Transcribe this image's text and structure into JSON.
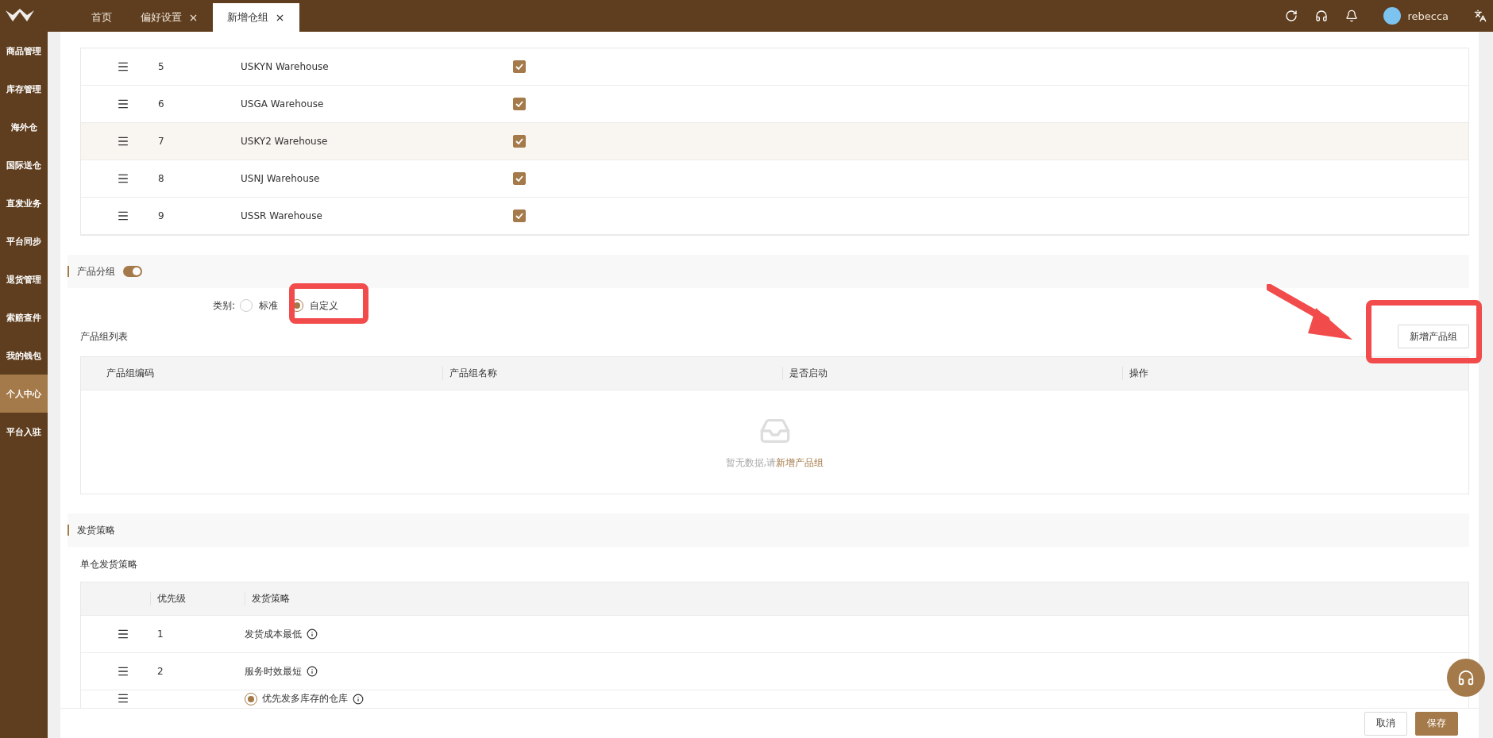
{
  "topbar": {
    "tabs": [
      {
        "label": "首页",
        "closable": false,
        "selected": false
      },
      {
        "label": "偏好设置",
        "closable": true,
        "selected": false
      },
      {
        "label": "新增仓组",
        "closable": true,
        "selected": true
      }
    ],
    "user": "rebecca"
  },
  "sidebar": {
    "items": [
      {
        "label": "商品管理",
        "selected": false
      },
      {
        "label": "库存管理",
        "selected": false
      },
      {
        "label": "海外仓",
        "selected": false
      },
      {
        "label": "国际送仓",
        "selected": false
      },
      {
        "label": "直发业务",
        "selected": false
      },
      {
        "label": "平台同步",
        "selected": false
      },
      {
        "label": "退货管理",
        "selected": false
      },
      {
        "label": "索赔查件",
        "selected": false
      },
      {
        "label": "我的钱包",
        "selected": false
      },
      {
        "label": "个人中心",
        "selected": true
      },
      {
        "label": "平台入驻",
        "selected": false
      }
    ]
  },
  "warehouses": {
    "rows": [
      {
        "index": "5",
        "name": "USKYN Warehouse",
        "checked": true,
        "highlighted": false
      },
      {
        "index": "6",
        "name": "USGA Warehouse",
        "checked": true,
        "highlighted": false
      },
      {
        "index": "7",
        "name": "USKY2 Warehouse",
        "checked": true,
        "highlighted": true
      },
      {
        "index": "8",
        "name": "USNJ Warehouse",
        "checked": true,
        "highlighted": false
      },
      {
        "index": "9",
        "name": "USSR Warehouse",
        "checked": true,
        "highlighted": false
      }
    ]
  },
  "product_group": {
    "title": "产品分组",
    "enabled": true,
    "category_label": "类别:",
    "options": [
      {
        "label": "标准",
        "selected": false
      },
      {
        "label": "自定义",
        "selected": true
      }
    ],
    "list_title": "产品组列表",
    "add_button": "新增产品组",
    "columns": [
      "产品组编码",
      "产品组名称",
      "是否启动",
      "操作"
    ],
    "empty_text": "暂无数据,请",
    "empty_link": "新增产品组"
  },
  "shipping": {
    "title": "发货策略",
    "subtitle": "单仓发货策略",
    "columns": [
      "优先级",
      "发货策略"
    ],
    "rows": [
      {
        "priority": "1",
        "strategy": "发货成本最低",
        "kind": "plain"
      },
      {
        "priority": "2",
        "strategy": "服务时效最短",
        "kind": "plain"
      },
      {
        "strategy": "优先发多库存的仓库",
        "kind": "radio",
        "selected": true
      }
    ]
  },
  "footer": {
    "cancel": "取消",
    "save": "保存"
  },
  "annotations": [
    {
      "kind": "box"
    },
    {
      "kind": "box"
    },
    {
      "kind": "arrow"
    }
  ]
}
